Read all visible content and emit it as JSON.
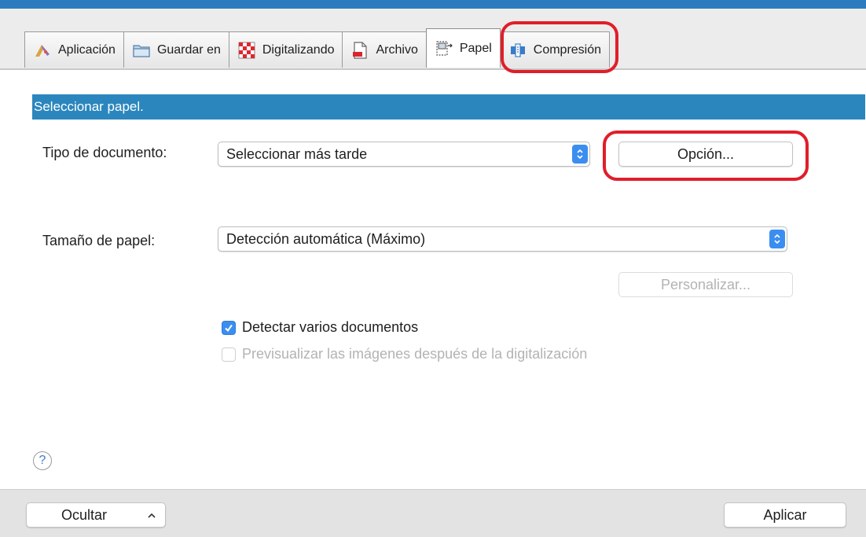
{
  "tabs": [
    {
      "label": "Aplicación",
      "icon": "application-icon"
    },
    {
      "label": "Guardar en",
      "icon": "folder-icon"
    },
    {
      "label": "Digitalizando",
      "icon": "scanning-icon"
    },
    {
      "label": "Archivo",
      "icon": "file-icon"
    },
    {
      "label": "Papel",
      "icon": "paper-icon",
      "selected": true
    },
    {
      "label": "Compresión",
      "icon": "compression-icon"
    }
  ],
  "section": {
    "title": "Seleccionar papel."
  },
  "document_type": {
    "label": "Tipo de documento:",
    "value": "Seleccionar más tarde",
    "option_button": "Opción..."
  },
  "paper_size": {
    "label": "Tamaño de papel:",
    "value": "Detección automática (Máximo)",
    "customize_button": "Personalizar..."
  },
  "checkboxes": {
    "detect_multiple": {
      "label": "Detectar varios documentos",
      "checked": true
    },
    "preview_images": {
      "label": "Previsualizar las imágenes después de la digitalización",
      "checked": false,
      "disabled": true
    }
  },
  "help": {
    "glyph": "?"
  },
  "footer": {
    "hide_button": "Ocultar",
    "apply_button": "Aplicar"
  },
  "colors": {
    "accent": "#2b86bd",
    "highlight": "#e01e2a",
    "checkbox": "#3b8ef0"
  }
}
